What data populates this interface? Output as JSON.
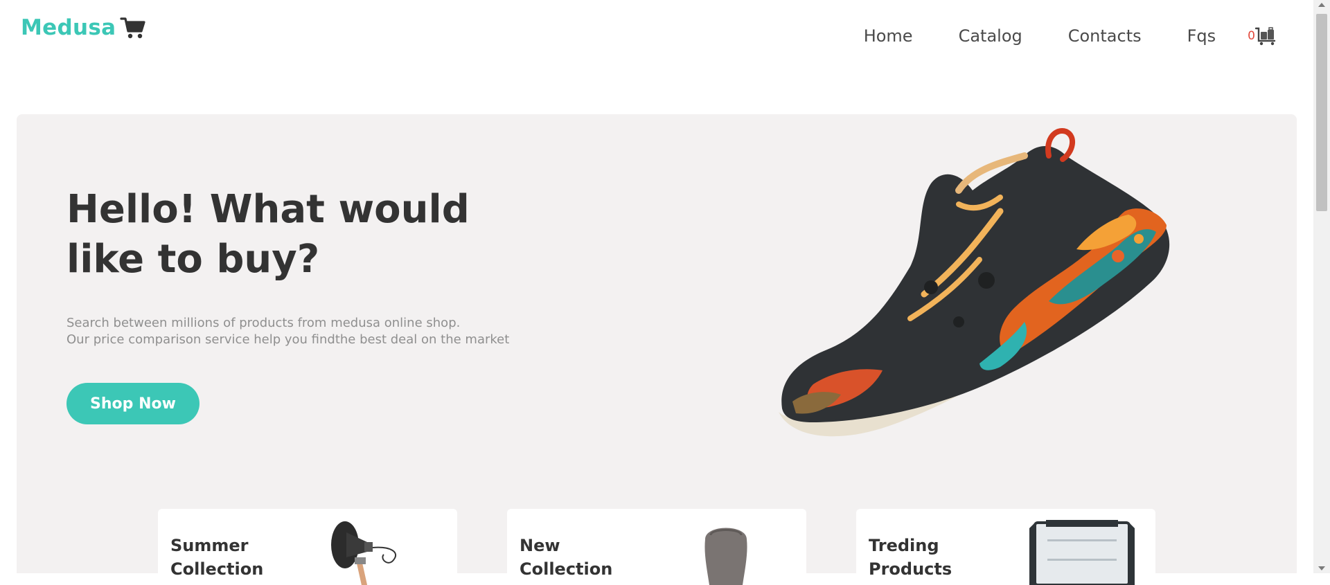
{
  "header": {
    "logo_text": "Medusa",
    "logo_icon": "shopping-cart-icon",
    "nav": [
      {
        "label": "Home"
      },
      {
        "label": "Catalog"
      },
      {
        "label": "Contacts"
      },
      {
        "label": "Fqs"
      }
    ],
    "cart_count": "0",
    "cart_icon": "luggage-cart-icon"
  },
  "hero": {
    "title": "Hello! What would like to buy?",
    "description_line1": "Search between millions of products from medusa online shop.",
    "description_line2": "Our price comparison service help you findthe best deal on the market",
    "button_label": "Shop Now",
    "image": "sneaker-image"
  },
  "cards": [
    {
      "title": "Summer Collection",
      "image": "lamp-image"
    },
    {
      "title": "New Collection",
      "image": "chair-image"
    },
    {
      "title": "Treding Products",
      "image": "refrigerator-image"
    }
  ],
  "colors": {
    "accent": "#3cc7b6",
    "badge": "#e2483b",
    "hero_bg": "#f3f1f1",
    "text": "#333333",
    "muted": "#8f8f8f"
  }
}
